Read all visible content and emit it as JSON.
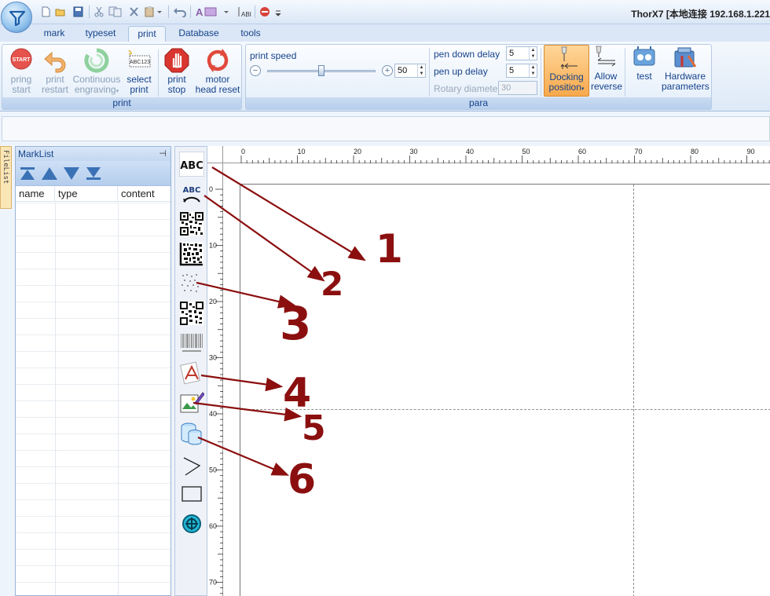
{
  "window": {
    "title": "ThorX7 [本地连接 192.168.1.221"
  },
  "quick_access": [
    "new-icon",
    "open-icon",
    "save-icon",
    "cut-icon",
    "copy-icon",
    "delete-icon",
    "paste-icon",
    "undo-icon",
    "text-style-icon",
    "arrange-icon",
    "stop-icon",
    "more-icon"
  ],
  "tabs": [
    {
      "label": "mark",
      "active": false
    },
    {
      "label": "typeset",
      "active": false
    },
    {
      "label": "print",
      "active": true
    },
    {
      "label": "Database",
      "active": false
    },
    {
      "label": "tools",
      "active": false
    }
  ],
  "ribbon": {
    "print_group": {
      "label": "print",
      "buttons": [
        {
          "line1": "pring",
          "line2": "start",
          "icon": "start-icon",
          "enabled": false
        },
        {
          "line1": "print",
          "line2": "restart",
          "icon": "restart-arrow-icon",
          "enabled": false
        },
        {
          "line1": "Continuous",
          "line2": "engraving",
          "icon": "recycle-icon",
          "enabled": false
        },
        {
          "line1": "select",
          "line2": "print",
          "icon": "select-print-icon",
          "enabled": true
        },
        {
          "line1": "print",
          "line2": "stop",
          "icon": "stop-hand-icon",
          "enabled": true
        },
        {
          "line1": "motor",
          "line2": "head reset",
          "icon": "reset-icon",
          "enabled": true
        }
      ]
    },
    "para_group": {
      "label": "para",
      "print_speed_label": "print speed",
      "print_speed_value": "50",
      "print_speed_level": 0.5,
      "minus_symbol": "−",
      "plus_symbol": "+",
      "pen_down_delay_label": "pen down delay",
      "pen_down_delay_value": "5",
      "pen_up_delay_label": "pen up delay",
      "pen_up_delay_value": "5",
      "rotary_diameter_label": "Rotary diameter",
      "rotary_diameter_value": "30",
      "docking_line1": "Docking",
      "docking_line2": "position",
      "allow_line1": "Allow",
      "allow_line2": "reverse",
      "test_label": "test",
      "hardware_line1": "Hardware",
      "hardware_line2": "parameters"
    }
  },
  "filelist_tab": "FileList",
  "marklist": {
    "title": "MarkList",
    "pin_symbol": "⊣",
    "columns": [
      "name",
      "type",
      "content"
    ],
    "nav_buttons": [
      "move-top-icon",
      "move-up-icon",
      "move-down-icon",
      "move-bottom-icon"
    ]
  },
  "tools": [
    {
      "name": "text-tool",
      "glyph": "ABC"
    },
    {
      "name": "arc-text-tool",
      "glyph": "ABC"
    },
    {
      "name": "qr-code-tool"
    },
    {
      "name": "datamatrix-tool"
    },
    {
      "name": "dot-matrix-tool"
    },
    {
      "name": "pdf417-tool"
    },
    {
      "name": "barcode-tool"
    },
    {
      "name": "vector-file-tool"
    },
    {
      "name": "image-tool"
    },
    {
      "name": "database-tool"
    },
    {
      "name": "line-tool"
    },
    {
      "name": "rectangle-tool"
    },
    {
      "name": "circle-tool"
    }
  ],
  "rulers": {
    "h_labels": [
      "0",
      "10",
      "20",
      "30",
      "40",
      "50",
      "60",
      "70",
      "80",
      "90"
    ],
    "v_labels": [
      "0",
      "10",
      "20",
      "30",
      "40",
      "50",
      "60",
      "70"
    ]
  },
  "annotations": [
    "1",
    "2",
    "3",
    "4",
    "5",
    "6"
  ],
  "colors": {
    "ribbon_text": "#15428b",
    "annotation": "#8b0f0f",
    "docking_active": "#f7b45a"
  }
}
